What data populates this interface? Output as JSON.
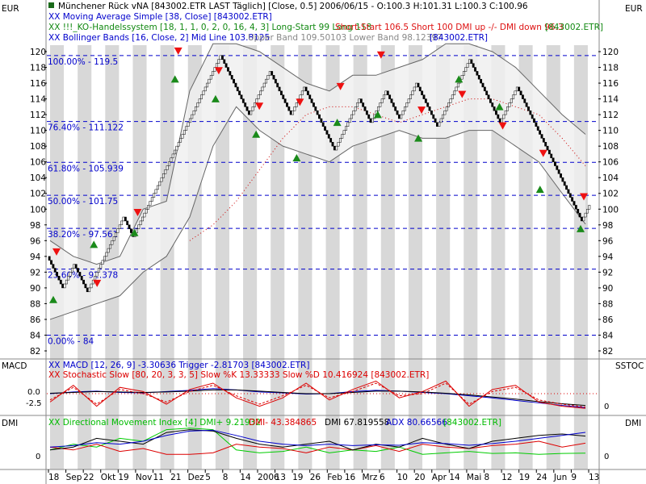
{
  "currency_left": "EUR",
  "currency_right": "EUR",
  "header": {
    "title": "Münchener Rück vNA [843002.ETR LAST Täglich] [Close, 0.5] 2006/06/15 - O:100.3 H:101.31 L:100.3 C:100.96",
    "ma": "XX Moving Average Simple [38, Close] [843002.ETR]",
    "ko_a": "XX !!!_KO-Handelssystem [18, 1, 1, 0, 2, 0, 16, 4, 3] Long-Start 99 Long 118",
    "ko_b": "Short-Start 106.5 Short 100 DMI up -/- DMI down 96.3",
    "ko_c": "[843002.ETR]",
    "bb_a": "XX Bollinger Bands [16, Close, 2] Mid Line 103.8125",
    "bb_b": "Upper Band 109.50103 Lower Band 98.12397",
    "bb_c": "[843002.ETR]"
  },
  "fib_levels": [
    {
      "label": "100.00% - 119.5",
      "value": 119.5
    },
    {
      "label": "76.40% - 111.122",
      "value": 111.122
    },
    {
      "label": "61.80% - 105.939",
      "value": 105.939
    },
    {
      "label": "50.00% - 101.75",
      "value": 101.75
    },
    {
      "label": "38.20% - 97.561",
      "value": 97.561
    },
    {
      "label": "23.60% - 92.378",
      "value": 92.378
    },
    {
      "label": "0.00% - 84",
      "value": 84
    }
  ],
  "price_ticks": [
    "82",
    "84",
    "86",
    "88",
    "90",
    "92",
    "94",
    "96",
    "98",
    "100",
    "102",
    "104",
    "106",
    "108",
    "110",
    "112",
    "114",
    "116",
    "118",
    "120"
  ],
  "macd_panel": {
    "label_left": "MACD",
    "label_right": "SSTOC",
    "line1": "XX MACD [12, 26, 9] -3.30636 Trigger -2.81703 [843002.ETR]",
    "line2": "XX Stochastic Slow [80, 20, 3, 3, 5] Slow %K 13.33333 Slow %D 10.416924 [843002.ETR]",
    "ticks_left": [
      "0.0",
      "-2.5"
    ],
    "ticks_right": [
      "0"
    ]
  },
  "dmi_panel": {
    "label_left": "DMI",
    "label_right": "DMI",
    "line_a": "XX Directional Movement Index [4] DMI+ 9.21932",
    "line_b": "DMI- 43.384865",
    "line_c": "DMI 67.819558",
    "line_d": "ADX 80.66566",
    "line_e": "[843002.ETR]",
    "ticks": [
      "0",
      "0"
    ]
  },
  "x_labels": [
    "18",
    "Sep",
    "22",
    "Okt",
    "19",
    "Nov",
    "11",
    "21",
    "Dez",
    "5",
    "8",
    "14",
    "2006",
    "13",
    "19",
    "26",
    "Feb",
    "16",
    "Mrz",
    "6",
    "10",
    "20",
    "Apr",
    "14",
    "Mai",
    "8",
    "12",
    "19",
    "24",
    "Jun",
    "9",
    "13"
  ],
  "colors": {
    "renko_up": "#ffffff",
    "renko_down": "#000000",
    "fib_line": "#0000cc",
    "band_fill": "#f0f0f0",
    "long_signal": "#1a8a1a",
    "short_signal": "#ee1111",
    "macd": "#0000cc",
    "trigger": "#000000",
    "stoch": "#dd0000",
    "dmi_plus": "#00cc00",
    "dmi_minus": "#dd0000",
    "dmi": "#000000",
    "adx": "#0000cc"
  },
  "chart_data": [
    {
      "type": "line",
      "subtype": "renko",
      "title": "Münchener Rück vNA [843002.ETR LAST Täglich] [Close, 0.5]",
      "ylabel": "EUR",
      "ylim": [
        82,
        121
      ],
      "box_size": 0.5,
      "renko_path": [
        94,
        90,
        93,
        89.5,
        99,
        96.5,
        117,
        119.5,
        112,
        117.5,
        112,
        115.5,
        107.5,
        114,
        111,
        115,
        111.5,
        116,
        110.5,
        119,
        111,
        115.5,
        98.5,
        100.5
      ],
      "series": [
        {
          "name": "Moving Average Simple [38, Close]",
          "values": [
            null,
            null,
            null,
            null,
            null,
            null,
            96,
            98,
            101,
            105,
            109,
            112,
            113,
            113,
            112,
            111,
            112,
            113,
            114,
            114,
            113,
            112,
            109,
            105.5
          ]
        },
        {
          "name": "Bollinger Upper Band",
          "values": [
            96,
            94,
            93,
            94,
            100,
            101,
            115,
            121,
            121,
            120,
            118,
            116,
            115,
            117,
            117,
            118,
            119,
            121,
            121,
            120,
            118,
            115,
            112,
            109.5
          ]
        },
        {
          "name": "Bollinger Lower Band",
          "values": [
            86,
            87,
            88,
            89,
            92,
            94,
            99,
            108,
            113,
            110,
            108,
            107,
            106,
            108,
            109,
            110,
            109,
            109,
            110,
            110,
            108,
            106,
            102,
            98.1
          ]
        }
      ],
      "long_signals": [
        89.5,
        96.5,
        98,
        117.5,
        115,
        110.5,
        107.5,
        112,
        113,
        110,
        117.5,
        114,
        103.5,
        98.5
      ],
      "short_signals": [
        94,
        90,
        99,
        119.5,
        117,
        112.5,
        113,
        115,
        119,
        112,
        114,
        110,
        106.5,
        101
      ]
    },
    {
      "type": "line",
      "title": "MACD [12, 26, 9] / Stochastic Slow [80, 20, 3, 3, 5]",
      "ylim": [
        -5,
        5
      ],
      "series": [
        {
          "name": "MACD",
          "values": [
            0,
            0.4,
            0.6,
            0.3,
            0.2,
            0.5,
            0.8,
            1.2,
            0.9,
            0.4,
            0.2,
            -0.1,
            0,
            0.5,
            0.8,
            0.6,
            0.3,
            0,
            -0.5,
            -1,
            -1.6,
            -2.2,
            -2.8,
            -3.31
          ]
        },
        {
          "name": "Trigger",
          "values": [
            0.1,
            0.3,
            0.5,
            0.4,
            0.3,
            0.4,
            0.6,
            0.9,
            0.9,
            0.6,
            0.3,
            0,
            0,
            0.3,
            0.6,
            0.6,
            0.4,
            0.1,
            -0.3,
            -0.8,
            -1.3,
            -1.9,
            -2.4,
            -2.82
          ]
        },
        {
          "name": "Slow %K",
          "values": [
            -2,
            2,
            -3,
            1.5,
            0.5,
            -2.5,
            1,
            2.5,
            -1,
            -3,
            -1,
            2.5,
            -1.5,
            1,
            3,
            -1,
            0.5,
            3,
            -3,
            1,
            2,
            -2,
            -3,
            -3.5
          ]
        },
        {
          "name": "Slow %D",
          "values": [
            -1.5,
            1.5,
            -2.5,
            1,
            0,
            -2,
            0.5,
            2,
            -0.5,
            -2.5,
            -0.5,
            2,
            -1,
            0.5,
            2.5,
            -0.5,
            0,
            2.5,
            -2.5,
            0.5,
            1.5,
            -1.5,
            -2.5,
            -3.2
          ]
        }
      ]
    },
    {
      "type": "line",
      "title": "Directional Movement Index [4]",
      "ylim": [
        0,
        100
      ],
      "series": [
        {
          "name": "DMI+",
          "values": [
            20,
            40,
            30,
            60,
            50,
            90,
            95,
            90,
            20,
            10,
            15,
            30,
            10,
            20,
            15,
            30,
            5,
            10,
            15,
            8,
            10,
            5,
            8,
            9.2
          ]
        },
        {
          "name": "DMI-",
          "values": [
            30,
            20,
            40,
            15,
            25,
            5,
            5,
            10,
            40,
            30,
            25,
            10,
            30,
            20,
            35,
            15,
            40,
            30,
            25,
            35,
            40,
            50,
            30,
            43.4
          ]
        },
        {
          "name": "DMI",
          "values": [
            20,
            30,
            60,
            50,
            40,
            80,
            90,
            85,
            60,
            40,
            30,
            40,
            50,
            20,
            40,
            30,
            60,
            40,
            25,
            50,
            60,
            70,
            75,
            67.8
          ]
        },
        {
          "name": "ADX",
          "values": [
            30,
            35,
            45,
            40,
            50,
            70,
            85,
            88,
            70,
            50,
            40,
            35,
            40,
            35,
            38,
            36,
            45,
            42,
            36,
            42,
            50,
            60,
            70,
            80.7
          ]
        }
      ]
    }
  ]
}
